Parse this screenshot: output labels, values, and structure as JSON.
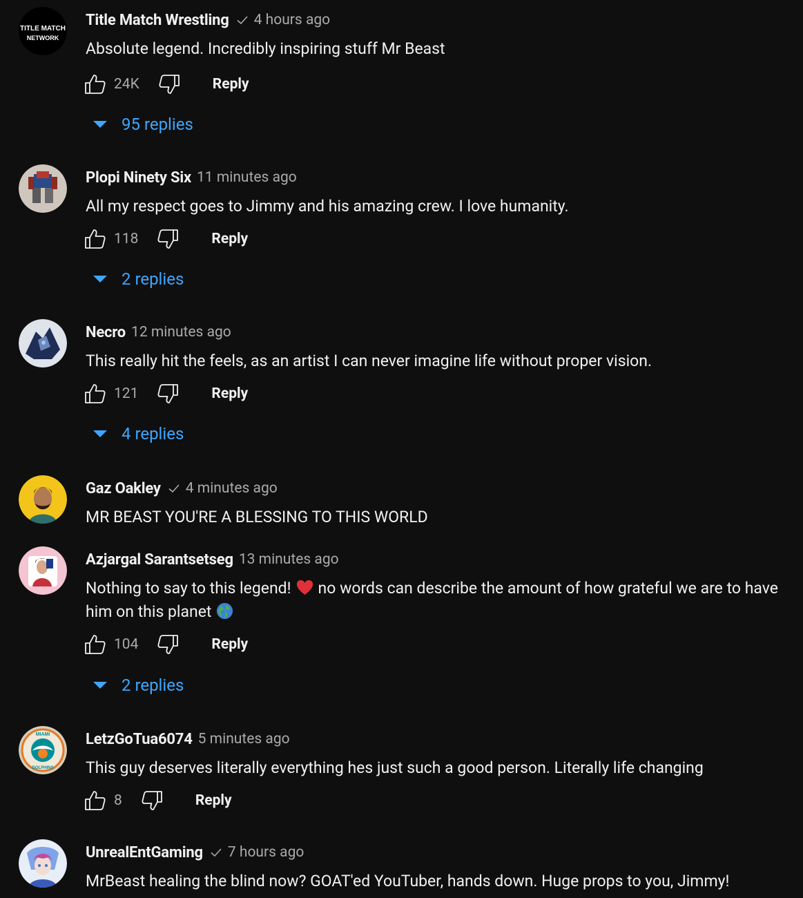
{
  "comments": [
    {
      "author": "Title Match Wrestling",
      "verified": true,
      "time": "4 hours ago",
      "text": "Absolute legend. Incredibly inspiring stuff Mr Beast",
      "likes": "24K",
      "reply_label": "Reply",
      "replies_label": "95 replies",
      "avatar": "title-match-network-logo",
      "avatar_text": [
        "TITLE MATCH",
        "NETWORK"
      ]
    },
    {
      "author": "Plopi Ninety Six",
      "verified": false,
      "time": "11 minutes ago",
      "text": "All my respect goes to Jimmy and his amazing crew. I love humanity.",
      "likes": "118",
      "reply_label": "Reply",
      "replies_label": "2 replies",
      "avatar": "robot-figure-avatar"
    },
    {
      "author": "Necro",
      "verified": false,
      "time": "12 minutes ago",
      "text": "This really hit the feels, as an artist I can never imagine life without proper vision.",
      "likes": "121",
      "reply_label": "Reply",
      "replies_label": "4 replies",
      "avatar": "robot-figure-avatar"
    },
    {
      "author": "Gaz Oakley",
      "verified": true,
      "time": "4 minutes ago",
      "text": "MR BEAST YOU'RE A BLESSING TO THIS WORLD",
      "avatar": "person-yellow-avatar"
    },
    {
      "author": "Azjargal Sarantsetseg",
      "verified": false,
      "time": "13 minutes ago",
      "text_part1": "Nothing to say to this legend!",
      "text_part2": "no words can describe the amount of how grateful we are to have him on this planet",
      "emoji1": "red-heart-emoji",
      "emoji2": "globe-emoji",
      "likes": "104",
      "reply_label": "Reply",
      "replies_label": "2 replies",
      "avatar": "person-pink-avatar"
    },
    {
      "author": "LetzGoTua6074",
      "verified": false,
      "time": "5 minutes ago",
      "text": "This guy deserves literally everything hes just such a good person. Literally life changing",
      "likes": "8",
      "reply_label": "Reply",
      "avatar": "miami-dolphins-logo",
      "avatar_text": [
        "MIAMI",
        "DOLPHINS"
      ]
    },
    {
      "author": "UnrealEntGaming",
      "verified": true,
      "time": "7 hours ago",
      "text": "MrBeast healing the blind now? GOAT'ed YouTuber, hands down. Huge props to you, Jimmy!",
      "avatar": "anime-character-avatar"
    }
  ],
  "colors": {
    "background": "#0f0f0f",
    "text": "#f1f1f1",
    "secondary": "#aaaaaa",
    "link": "#3ea6ff"
  }
}
